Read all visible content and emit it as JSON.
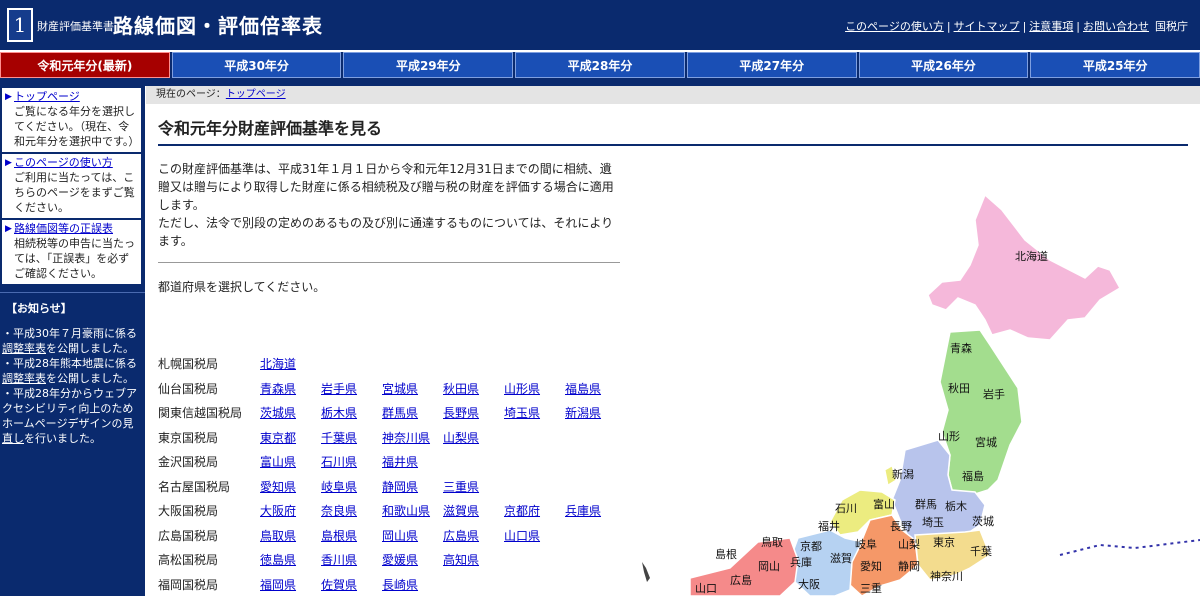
{
  "header": {
    "logo_number": "1",
    "subtitle": "財産評価基準書",
    "title": "路線価図・評価倍率表",
    "links": [
      "このページの使い方",
      "サイトマップ",
      "注意事項",
      "お問い合わせ"
    ],
    "agency": "国税庁"
  },
  "tabs": [
    {
      "label": "令和元年分(最新)",
      "active": true
    },
    {
      "label": "平成30年分"
    },
    {
      "label": "平成29年分"
    },
    {
      "label": "平成28年分"
    },
    {
      "label": "平成27年分"
    },
    {
      "label": "平成26年分"
    },
    {
      "label": "平成25年分"
    }
  ],
  "sidebar": {
    "boxes": [
      {
        "link": "トップページ",
        "text": "ご覧になる年分を選択してください。（現在、令和元年分を選択中です。）"
      },
      {
        "link": "このページの使い方",
        "text": "ご利用に当たっては、こちらのページをまずご覧ください。"
      },
      {
        "link": "路線価図等の正誤表",
        "text": "相続税等の申告に当たっては、「正誤表」を必ずご確認ください。"
      }
    ],
    "notice_heading": "【お知らせ】",
    "notices": [
      {
        "text1": "・平成30年７月豪雨に係る",
        "link": "調整率表",
        "text2": "を公開しました。"
      },
      {
        "text1": "・平成28年熊本地震に係る",
        "link": "調整率表",
        "text2": "を公開しました。"
      },
      {
        "text1": "・平成28年分からウェブアクセシビリティ向上のためホームページデザインの見",
        "link": "直し",
        "text2": "を行いました。"
      }
    ]
  },
  "breadcrumb": {
    "prefix": "現在のページ：",
    "link": "トップページ"
  },
  "main": {
    "title": "令和元年分財産評価基準を見る",
    "intro1": "この財産評価基準は、平成31年１月１日から令和元年12月31日までの間に相続、遺贈又は贈与により取得した財産に係る相続税及び贈与税の財産を評価する場合に適用します。",
    "intro2": "ただし、法令で別段の定めのあるもの及び別に通達するものについては、それによります。",
    "select_prompt": "都道府県を選択してください。"
  },
  "bureaus": [
    {
      "name": "札幌国税局",
      "prefs": [
        "北海道"
      ]
    },
    {
      "name": "仙台国税局",
      "prefs": [
        "青森県",
        "岩手県",
        "宮城県",
        "秋田県",
        "山形県",
        "福島県"
      ]
    },
    {
      "name": "関東信越国税局",
      "prefs": [
        "茨城県",
        "栃木県",
        "群馬県",
        "長野県",
        "埼玉県",
        "新潟県"
      ]
    },
    {
      "name": "東京国税局",
      "prefs": [
        "東京都",
        "千葉県",
        "神奈川県",
        "山梨県"
      ]
    },
    {
      "name": "金沢国税局",
      "prefs": [
        "富山県",
        "石川県",
        "福井県"
      ]
    },
    {
      "name": "名古屋国税局",
      "prefs": [
        "愛知県",
        "岐阜県",
        "静岡県",
        "三重県"
      ]
    },
    {
      "name": "大阪国税局",
      "prefs": [
        "大阪府",
        "奈良県",
        "和歌山県",
        "滋賀県",
        "京都府",
        "兵庫県"
      ]
    },
    {
      "name": "広島国税局",
      "prefs": [
        "鳥取県",
        "島根県",
        "岡山県",
        "広島県",
        "山口県"
      ]
    },
    {
      "name": "高松国税局",
      "prefs": [
        "徳島県",
        "香川県",
        "愛媛県",
        "高知県"
      ]
    },
    {
      "name": "福岡国税局",
      "prefs": [
        "福岡県",
        "佐賀県",
        "長崎県"
      ]
    }
  ],
  "map": {
    "labels": [
      "北海道",
      "青森",
      "秋田",
      "岩手",
      "山形",
      "宮城",
      "新潟",
      "福島",
      "富山",
      "石川",
      "群馬",
      "栃木",
      "福井",
      "長野",
      "埼玉",
      "茨城",
      "京都",
      "岐阜",
      "山梨",
      "東京",
      "鳥取",
      "島根",
      "兵庫",
      "滋賀",
      "千葉",
      "岡山",
      "大阪",
      "愛知",
      "静岡",
      "神奈川",
      "広島",
      "山口",
      "三重"
    ],
    "colors": {
      "hokkaido": "#f5b8da",
      "tohoku": "#a3dd8e",
      "kanto": "#b8c4ec",
      "tokyo": "#f3dc8e",
      "kanazawa": "#ecec80",
      "nagoya": "#f59868",
      "osaka": "#b6d2f2",
      "hiroshima": "#f58a8a"
    }
  }
}
